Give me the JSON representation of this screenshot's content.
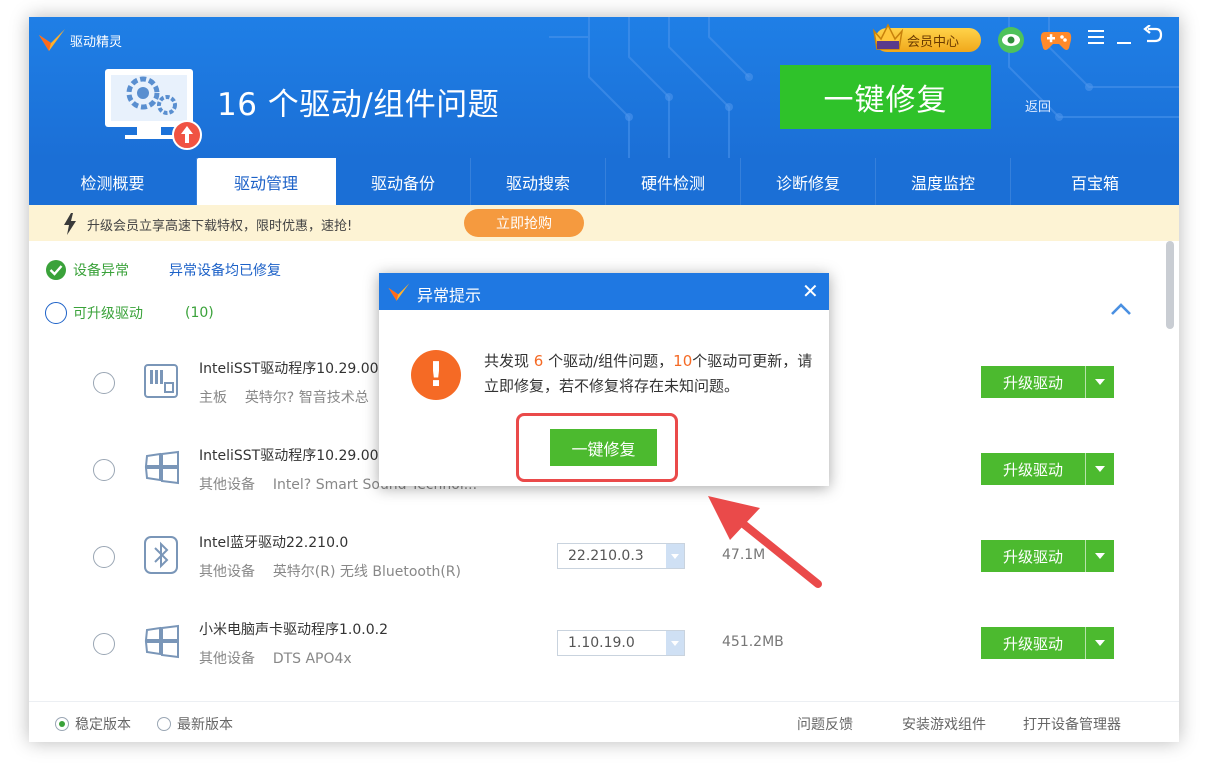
{
  "app": {
    "title": "驱动精灵",
    "headline": "16 个驱动/组件问题",
    "fix_button": "一键修复",
    "back_label": "返回",
    "vip_label": "会员中心",
    "colors": {
      "header": "#1b6fd6",
      "fix_green": "#2fc22a",
      "accent_orange": "#f56a25"
    }
  },
  "tabs": [
    {
      "label": "检测概要"
    },
    {
      "label": "驱动管理",
      "active": true
    },
    {
      "label": "驱动备份"
    },
    {
      "label": "驱动搜索"
    },
    {
      "label": "硬件检测"
    },
    {
      "label": "诊断修复"
    },
    {
      "label": "温度监控"
    },
    {
      "label": "百宝箱"
    }
  ],
  "promo": {
    "text": "升级会员立享高速下载特权，限时优惠，速抢!",
    "button": "立即抢购"
  },
  "status": {
    "abnormal_label": "设备异常",
    "abnormal_note": "异常设备均已修复",
    "upgradable_label": "可升级驱动",
    "upgradable_count": "(10)"
  },
  "drivers": [
    {
      "name": "InteliSST驱动程序10.29.00",
      "category": "主板",
      "vendor": "英特尔? 智音技术总",
      "version": "",
      "size": "",
      "icon": "chip-icon",
      "action": "升级驱动"
    },
    {
      "name": "InteliSST驱动程序10.29.00",
      "category": "其他设备",
      "vendor": "Intel? Smart Sound Technol...",
      "version": "",
      "size": "",
      "icon": "windows-icon",
      "action": "升级驱动"
    },
    {
      "name": "Intel蓝牙驱动22.210.0",
      "category": "其他设备",
      "vendor": "英特尔(R) 无线 Bluetooth(R)",
      "version": "22.210.0.3",
      "size": "47.1M",
      "icon": "bluetooth-icon",
      "action": "升级驱动"
    },
    {
      "name": "小米电脑声卡驱动程序1.0.0.2",
      "category": "其他设备",
      "vendor": "DTS APO4x",
      "version": "1.10.19.0",
      "size": "451.2MB",
      "icon": "windows-icon",
      "action": "升级驱动"
    }
  ],
  "footer": {
    "stable": "稳定版本",
    "latest": "最新版本",
    "feedback": "问题反馈",
    "game_components": "安装游戏组件",
    "device_manager": "打开设备管理器"
  },
  "dialog": {
    "title": "异常提示",
    "close": "✕",
    "msg_pre": "共发现 ",
    "msg_n1": "6",
    "msg_mid": " 个驱动/组件问题，",
    "msg_n2": "10",
    "msg_post": "个驱动可更新，请立即修复，若不修复将存在未知问题。",
    "button": "一键修复"
  }
}
